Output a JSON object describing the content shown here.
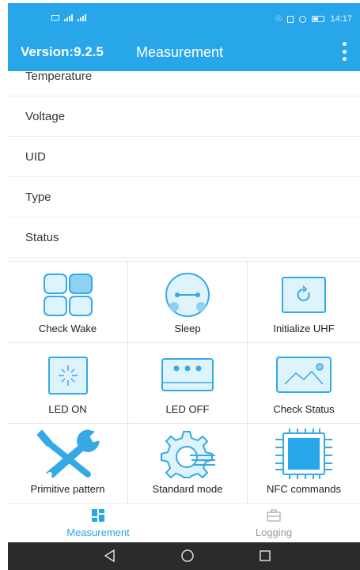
{
  "status_bar": {
    "time": "14:17"
  },
  "header": {
    "version": "Version:9.2.5",
    "title": "Measurement"
  },
  "info_rows": [
    {
      "label": "Temperature"
    },
    {
      "label": "Voltage"
    },
    {
      "label": "UID"
    },
    {
      "label": "Type"
    },
    {
      "label": "Status"
    }
  ],
  "actions": [
    {
      "label": "Check Wake",
      "icon": "check-wake-icon"
    },
    {
      "label": "Sleep",
      "icon": "sleep-icon"
    },
    {
      "label": "Initialize UHF",
      "icon": "initialize-uhf-icon"
    },
    {
      "label": "LED ON",
      "icon": "led-on-icon"
    },
    {
      "label": "LED OFF",
      "icon": "led-off-icon"
    },
    {
      "label": "Check Status",
      "icon": "check-status-icon"
    },
    {
      "label": "Primitive pattern",
      "icon": "tools-icon"
    },
    {
      "label": "Standard mode",
      "icon": "gear-icon"
    },
    {
      "label": "NFC commands",
      "icon": "chip-icon"
    }
  ],
  "bottom_nav": {
    "measurement": "Measurement",
    "logging": "Logging"
  },
  "colors": {
    "accent": "#27a6ea",
    "icon_light": "#dff3fd",
    "icon_stroke": "#35a9e6"
  }
}
